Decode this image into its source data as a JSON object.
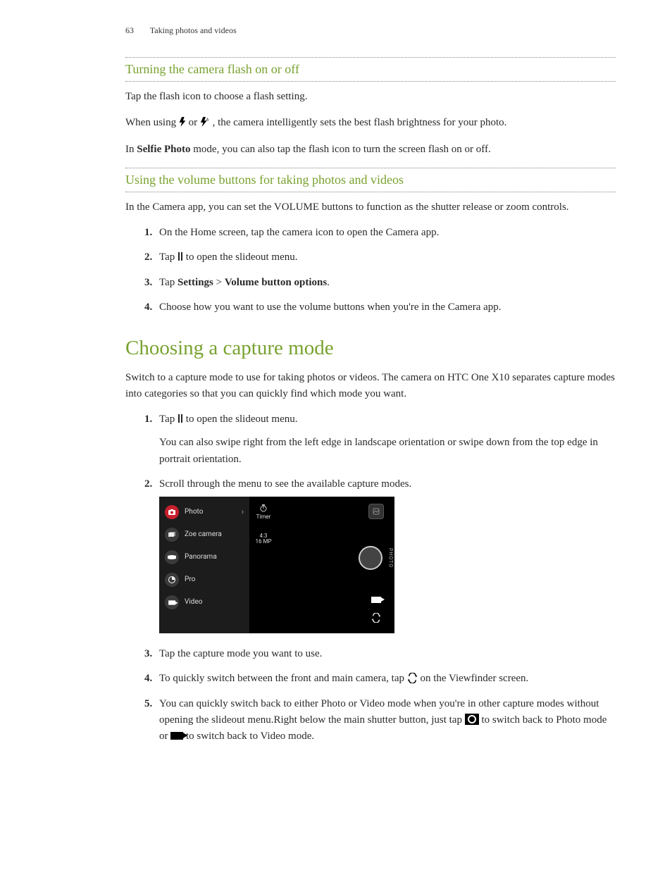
{
  "page": {
    "number": "63",
    "running_title": "Taking photos and videos"
  },
  "section_flash": {
    "heading": "Turning the camera flash on or off",
    "p1": "Tap the flash icon to choose a flash setting.",
    "p2_a": "When using ",
    "p2_b": " or ",
    "p2_c": ", the camera intelligently sets the best flash brightness for your photo.",
    "p3_a": "In ",
    "p3_bold": "Selfie Photo",
    "p3_b": " mode, you can also tap the flash icon to turn the screen flash on or off."
  },
  "section_volume": {
    "heading": "Using the volume buttons for taking photos and videos",
    "intro": "In the Camera app, you can set the VOLUME buttons to function as the shutter release or zoom controls.",
    "steps": {
      "s1": "On the Home screen, tap the camera icon to open the Camera app.",
      "s2_a": "Tap ",
      "s2_b": " to open the slideout menu.",
      "s3_a": "Tap ",
      "s3_b1": "Settings",
      "s3_gt": " > ",
      "s3_b2": "Volume button options",
      "s3_end": ".",
      "s4": "Choose how you want to use the volume buttons when you're in the Camera app."
    }
  },
  "section_capture": {
    "heading": "Choosing a capture mode",
    "intro": "Switch to a capture mode to use for taking photos or videos. The camera on HTC One X10 separates capture modes into categories so that you can quickly find which mode you want.",
    "steps": {
      "s1_a": "Tap ",
      "s1_b": " to open the slideout menu.",
      "s1_note": "You can also swipe right from the left edge in landscape orientation or swipe down from the top edge in portrait orientation.",
      "s2": "Scroll through the menu to see the available capture modes.",
      "s3": "Tap the capture mode you want to use.",
      "s4_a": "To quickly switch between the front and main camera, tap ",
      "s4_b": " on the Viewfinder screen.",
      "s5_a": "You can quickly switch back to either Photo or Video mode when you're in other capture modes without opening the slideout menu.Right below the main shutter button, just tap ",
      "s5_b": " to switch back to Photo mode or ",
      "s5_c": " to switch back to Video mode."
    }
  },
  "camera_ui": {
    "modes": {
      "photo": "Photo",
      "zoe": "Zoe camera",
      "panorama": "Panorama",
      "pro": "Pro",
      "video": "Video"
    },
    "opts": {
      "timer": "Timer",
      "ratio_top": "4:3",
      "ratio_bot": "16 MP"
    },
    "controls": {
      "shutter_label": "PHOTO"
    }
  }
}
